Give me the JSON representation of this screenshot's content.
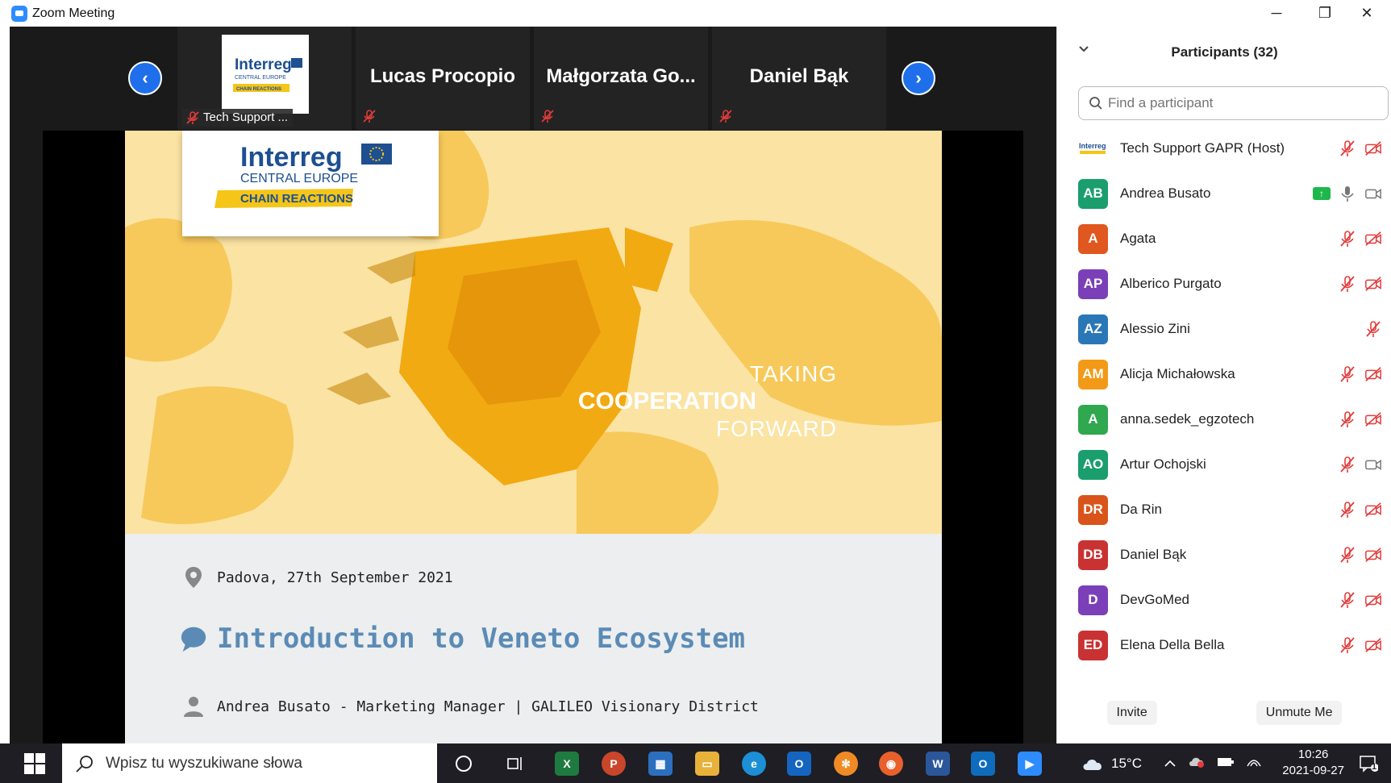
{
  "window": {
    "title": "Zoom Meeting",
    "minimize": "─",
    "restore": "❐",
    "close": "✕"
  },
  "strip": {
    "prev_arrow": "‹",
    "next_arrow": "›",
    "tiles": [
      {
        "label": "Tech Support ..."
      },
      {
        "label": "Lucas Procopio"
      },
      {
        "label": "Małgorzata  Go..."
      },
      {
        "label": "Daniel Bąk"
      }
    ]
  },
  "slide": {
    "logo": {
      "brand": "Interreg",
      "region": "CENTRAL EUROPE",
      "project": "CHAIN REACTIONS"
    },
    "tagline": {
      "line1": "TAKING",
      "line2": "COOPERATION",
      "line3": "FORWARD"
    },
    "place": "Padova, 27th September 2021",
    "title": "Introduction to Veneto Ecosystem",
    "author": "Andrea Busato - Marketing Manager | GALILEO Visionary District"
  },
  "participants": {
    "title": "Participants (32)",
    "search_placeholder": "Find a participant",
    "items": [
      {
        "initials": "",
        "name": "Tech Support GAPR (Host)",
        "color": "#ffffff",
        "logo": true,
        "mic": "muted",
        "video": "off"
      },
      {
        "initials": "AB",
        "name": "Andrea Busato",
        "color": "#1a9e6e",
        "sharing": true,
        "mic": "on",
        "video": "on"
      },
      {
        "initials": "A",
        "name": "Agata",
        "color": "#e0571f",
        "mic": "muted",
        "video": "off"
      },
      {
        "initials": "AP",
        "name": "Alberico Purgato",
        "color": "#7b3fb8",
        "mic": "muted",
        "video": "off"
      },
      {
        "initials": "AZ",
        "name": "Alessio Zini",
        "color": "#2a77b8",
        "mic": "muted",
        "video": "none"
      },
      {
        "initials": "AM",
        "name": "Alicja Michałowska",
        "color": "#f29a17",
        "mic": "muted",
        "video": "off"
      },
      {
        "initials": "A",
        "name": "anna.sedek_egzotech",
        "color": "#2fa84f",
        "mic": "muted",
        "video": "off"
      },
      {
        "initials": "AO",
        "name": "Artur Ochojski",
        "color": "#1a9e6e",
        "mic": "muted",
        "video": "on"
      },
      {
        "initials": "DR",
        "name": "Da Rin",
        "color": "#d9541a",
        "mic": "muted",
        "video": "off"
      },
      {
        "initials": "DB",
        "name": "Daniel Bąk",
        "color": "#c93232",
        "mic": "muted",
        "video": "off"
      },
      {
        "initials": "D",
        "name": "DevGoMed",
        "color": "#7b3fb8",
        "mic": "muted",
        "video": "off"
      },
      {
        "initials": "ED",
        "name": "Elena Della Bella",
        "color": "#c93232",
        "mic": "muted",
        "video": "off"
      }
    ],
    "invite": "Invite",
    "unmute": "Unmute Me"
  },
  "taskbar": {
    "search_placeholder": "Wpisz tu wyszukiwane słowa",
    "temperature": "15°C",
    "time": "10:26",
    "date": "2021-09-27",
    "notifications": "1"
  }
}
